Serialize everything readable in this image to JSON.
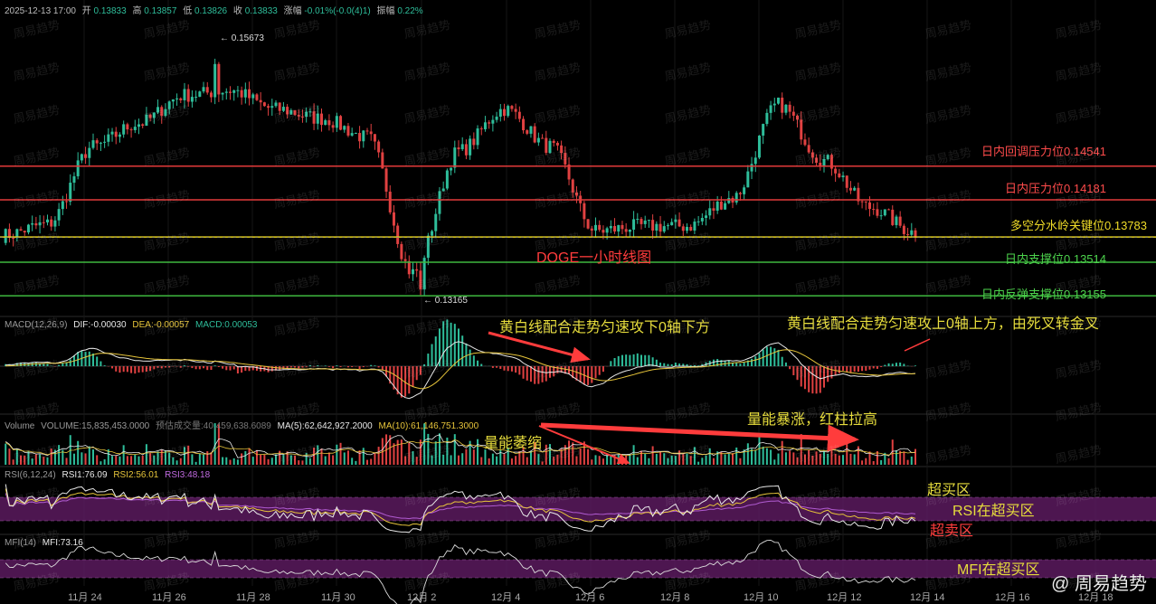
{
  "header": {
    "time": "2025-12-13 17:00",
    "open_label": "开",
    "open": "0.13833",
    "high_label": "高",
    "high": "0.13857",
    "low_label": "低",
    "low": "0.13826",
    "close_label": "收",
    "close": "0.13833",
    "change_label": "涨幅",
    "change": "-0.01%(-0.0(4)1)",
    "amplitude_label": "振幅",
    "amplitude": "0.22%"
  },
  "panels": {
    "macd": {
      "title": "MACD(12,26,9)",
      "dif": "DIF:-0.00030",
      "dea": "DEA:-0.00057",
      "macd": "MACD:0.00053"
    },
    "volume": {
      "title": "Volume",
      "volume": "VOLUME:15,835,453.0000",
      "est": "预估成交量:40,459,638.6089",
      "ma5": "MA(5):62,642,927.2000",
      "ma10": "MA(10):61,146,751.3000"
    },
    "rsi": {
      "title": "RSI(6,12,24)",
      "rsi1": "RSI1:76.09",
      "rsi2": "RSI2:56.01",
      "rsi3": "RSI3:48.18"
    },
    "mfi": {
      "title": "MFI(14)",
      "mfi": "MFI:73.16"
    }
  },
  "levels": [
    {
      "label": "日内回调压力位0.14541",
      "value": 0.14541,
      "color": "#e23a3a",
      "text_color": "#ff4b4b"
    },
    {
      "label": "日内压力位0.14181",
      "value": 0.14181,
      "color": "#e23a3a",
      "text_color": "#ff4b4b"
    },
    {
      "label": "多空分水岭关键位0.13783",
      "value": 0.13783,
      "color": "#e6d21e",
      "text_color": "#f0dc28"
    },
    {
      "label": "日内支撑位0.13514",
      "value": 0.13514,
      "color": "#3fb83f",
      "text_color": "#4cd34c"
    },
    {
      "label": "日内反弹支撑位0.13155",
      "value": 0.13155,
      "color": "#3fb83f",
      "text_color": "#4cd34c"
    }
  ],
  "annotations": {
    "chart_title": "DOGE一小时线图",
    "macd_left": "黄白线配合走势匀速攻下0轴下方",
    "macd_right": "黄白线配合走势匀速攻上0轴上方，由死叉转金叉",
    "vol_shrink": "量能萎缩",
    "vol_surge": "量能暴涨，红柱拉高",
    "overbought": "超买区",
    "rsi_note": "RSI在超买区",
    "oversold": "超卖区",
    "mfi_note": "MFI在超买区"
  },
  "watermark": "周易趋势",
  "brand": "@ 周易趋势",
  "colors": {
    "up": "#2ebd9a",
    "down": "#e04141",
    "white_line": "#e8e8e8",
    "yellow_line": "#e6c43a",
    "purple_line": "#b05bd1",
    "band": "#5a1a5e"
  },
  "chart_data": {
    "type": "candlestick",
    "title": "DOGE一小时线图",
    "x_ticks": [
      "11月 24",
      "11月 26",
      "11月 28",
      "11月 30",
      "12月 2",
      "12月 4",
      "12月 6",
      "12月 8",
      "12月 10",
      "12月 12",
      "12月 14",
      "12月 16",
      "12月 18"
    ],
    "price_range": [
      0.1305,
      0.1595
    ],
    "labelled_extremes": [
      {
        "label": "0.15673",
        "value": 0.15673,
        "kind": "high"
      },
      {
        "label": "0.13165",
        "value": 0.13165,
        "kind": "low"
      }
    ],
    "close_anchors": [
      {
        "date": "11月 23",
        "close": 0.138
      },
      {
        "date": "11月 24",
        "close": 0.1392
      },
      {
        "date": "11月 25",
        "close": 0.1475
      },
      {
        "date": "11月 26",
        "close": 0.15
      },
      {
        "date": "11月 27",
        "close": 0.153
      },
      {
        "date": "11月 28",
        "close": 0.1535
      },
      {
        "date": "11月 29",
        "close": 0.1515
      },
      {
        "date": "11月 30",
        "close": 0.1505
      },
      {
        "date": "12月 1",
        "close": 0.1485
      },
      {
        "date": "12月 2",
        "close": 0.134
      },
      {
        "date": "12月 3",
        "close": 0.147
      },
      {
        "date": "12月 4",
        "close": 0.1515
      },
      {
        "date": "12月 5",
        "close": 0.1475
      },
      {
        "date": "12月 6",
        "close": 0.1385
      },
      {
        "date": "12月 7",
        "close": 0.139
      },
      {
        "date": "12月 8",
        "close": 0.139
      },
      {
        "date": "12月 9",
        "close": 0.142
      },
      {
        "date": "12月 10",
        "close": 0.152
      },
      {
        "date": "12月 11",
        "close": 0.146
      },
      {
        "date": "12月 12",
        "close": 0.141
      },
      {
        "date": "12月 13",
        "close": 0.13833
      }
    ]
  }
}
